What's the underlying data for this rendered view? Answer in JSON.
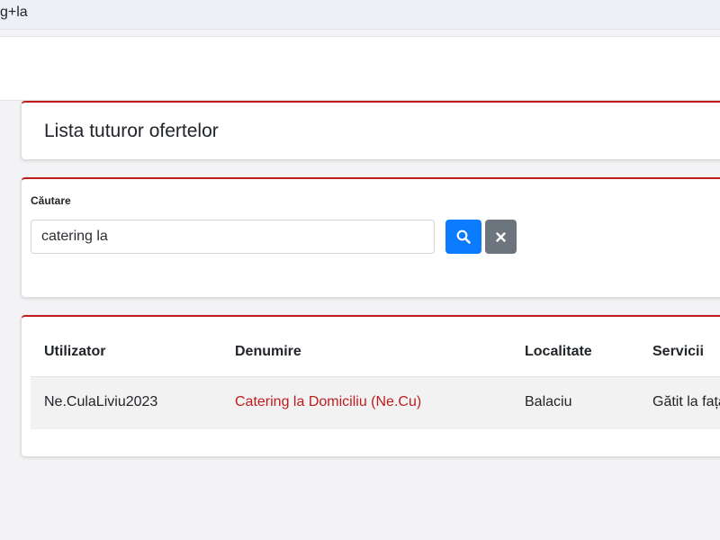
{
  "url_fragment": "g+la",
  "page_title": "Lista tuturor ofertelor",
  "search": {
    "label": "Căutare",
    "value": "catering la",
    "search_button_icon": "search-icon",
    "clear_button_icon": "close-icon"
  },
  "table": {
    "headers": [
      "Utilizator",
      "Denumire",
      "Localitate",
      "Servicii"
    ],
    "rows": [
      {
        "utilizator": "Ne.CulaLiviu2023",
        "denumire": "Catering la Domiciliu (Ne.Cu)",
        "localitate": "Balaciu",
        "servicii": "Gătit la fața"
      }
    ]
  },
  "colors": {
    "accent_red": "#bf1d1d",
    "primary_blue": "#0b7bff",
    "secondary_gray": "#6c757d"
  }
}
